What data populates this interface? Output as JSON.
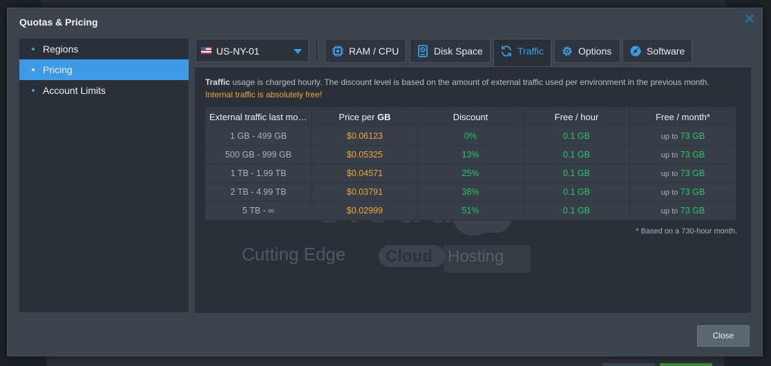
{
  "dialog": {
    "title": "Quotas & Pricing",
    "close_button": "Close"
  },
  "sidebar": {
    "items": [
      {
        "label": "Regions",
        "active": false
      },
      {
        "label": "Pricing",
        "active": true
      },
      {
        "label": "Account Limits",
        "active": false
      }
    ]
  },
  "region": {
    "selected": "US-NY-01"
  },
  "tabs": [
    {
      "label": "RAM / CPU",
      "icon": "chip-icon"
    },
    {
      "label": "Disk Space",
      "icon": "disk-icon"
    },
    {
      "label": "Traffic",
      "icon": "refresh-icon",
      "active": true
    },
    {
      "label": "Options",
      "icon": "gear-icon"
    },
    {
      "label": "Software",
      "icon": "disc-icon"
    }
  ],
  "traffic": {
    "desc_bold": "Traffic",
    "desc_rest": " usage is charged hourly. The discount level is based on the amount of external traffic used per environment in the previous month.",
    "desc_internal": "Internal traffic is absolutely free!",
    "columns": {
      "range": "External traffic last mo…",
      "price_prefix": "Price per ",
      "price_unit": "GB",
      "discount": "Discount",
      "free_hour": "Free / hour",
      "free_month": "Free / month*"
    },
    "rows": [
      {
        "range": "1 GB - 499 GB",
        "price": "$0.06123",
        "discount": "0%",
        "free_hour": "0.1 GB",
        "upto": "up to",
        "free_month": "73 GB"
      },
      {
        "range": "500 GB - 999 GB",
        "price": "$0.05325",
        "discount": "13%",
        "free_hour": "0.1 GB",
        "upto": "up to",
        "free_month": "73 GB"
      },
      {
        "range": "1 TB - 1.99 TB",
        "price": "$0.04571",
        "discount": "25%",
        "free_hour": "0.1 GB",
        "upto": "up to",
        "free_month": "73 GB"
      },
      {
        "range": "2 TB - 4.99 TB",
        "price": "$0.03791",
        "discount": "38%",
        "free_hour": "0.1 GB",
        "upto": "up to",
        "free_month": "73 GB"
      },
      {
        "range": "5 TB - ∞",
        "price": "$0.02999",
        "discount": "51%",
        "free_hour": "0.1 GB",
        "upto": "up to",
        "free_month": "73 GB"
      }
    ],
    "footnote": "* Based on a 730-hour month."
  },
  "watermark": {
    "line1": "AccuWeb",
    "line2": "Cloud",
    "tagline_a": "Cutting Edge",
    "tagline_b": "Cloud",
    "tagline_c": "Hosting"
  },
  "colors": {
    "accent": "#3aa0e6",
    "price": "#f2a53a",
    "positive": "#2fc46a"
  }
}
